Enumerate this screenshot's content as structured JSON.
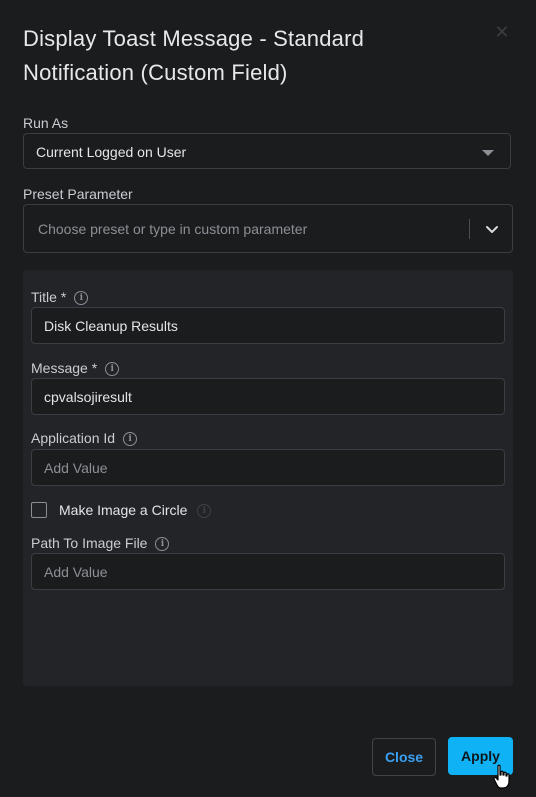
{
  "dialog": {
    "title": "Display Toast Message - Standard Notification (Custom Field)",
    "close_icon": "close-icon"
  },
  "run_as": {
    "label": "Run As",
    "selected": "Current Logged on User",
    "icon": "caret-down-icon"
  },
  "preset": {
    "label": "Preset Parameter",
    "placeholder": "Choose preset or type in custom parameter",
    "icon": "chevron-down-icon"
  },
  "fields": {
    "title": {
      "label": "Title *",
      "value": "Disk Cleanup Results",
      "icon": "info-icon"
    },
    "message": {
      "label": "Message *",
      "value": "cpvalsojiresult",
      "icon": "info-icon"
    },
    "application_id": {
      "label": "Application Id",
      "placeholder": "Add Value",
      "icon": "info-icon"
    },
    "make_image_circle": {
      "label": "Make Image a Circle",
      "checked": false,
      "icon": "info-icon"
    },
    "path_to_image": {
      "label": "Path To Image File",
      "placeholder": "Add Value",
      "icon": "info-icon"
    }
  },
  "footer": {
    "close_label": "Close",
    "apply_label": "Apply"
  },
  "colors": {
    "background": "#1b1c1e",
    "panel": "#232427",
    "accent": "#0fb2f5",
    "link": "#3ba0f2"
  }
}
